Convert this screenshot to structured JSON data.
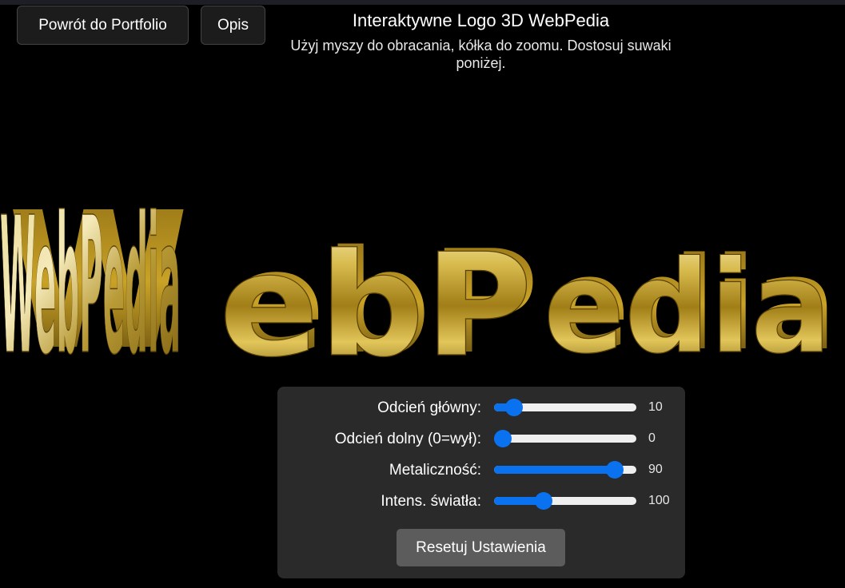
{
  "nav": {
    "back_label": "Powrót do Portfolio",
    "desc_label": "Opis"
  },
  "header": {
    "title": "Interaktywne Logo 3D WebPedia",
    "subtitle": "Użyj myszy do obracania, kółka do zoomu. Dostosuj suwaki poniżej."
  },
  "logo": {
    "text": "WebPedia",
    "colors": {
      "gold_light": "#f4e7a2",
      "gold_mid": "#c9a227",
      "gold_dark": "#6b4f08",
      "side": "#4a3606"
    }
  },
  "controls": {
    "sliders": [
      {
        "label": "Odcień główny:",
        "value": "10",
        "level": 0.14
      },
      {
        "label": "Odcień dolny (0=wył):",
        "value": "0",
        "level": 0.06
      },
      {
        "label": "Metaliczność:",
        "value": "90",
        "level": 0.85
      },
      {
        "label": "Intens. światła:",
        "value": "100",
        "level": 0.35
      }
    ],
    "reset_label": "Resetuj Ustawienia"
  },
  "colors": {
    "accent": "#0a72ef",
    "panel": "#2a2a2a",
    "background": "#000000"
  }
}
